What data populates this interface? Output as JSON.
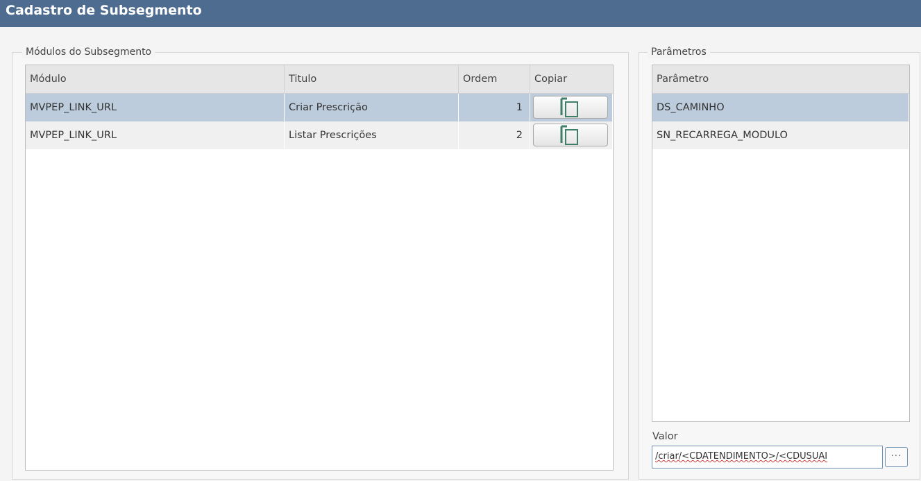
{
  "window": {
    "title": "Cadastro de Subsegmento"
  },
  "modulos": {
    "legend": "Módulos do Subsegmento",
    "columns": [
      "Módulo",
      "Titulo",
      "Ordem",
      "Copiar"
    ],
    "rows": [
      {
        "modulo": "MVPEP_LINK_URL",
        "titulo": "Criar Prescrição",
        "ordem": "1"
      },
      {
        "modulo": "MVPEP_LINK_URL",
        "titulo": "Listar Prescrições",
        "ordem": "2"
      }
    ],
    "copy_icon": "copy-icon"
  },
  "parametros": {
    "legend": "Parâmetros",
    "column": "Parâmetro",
    "rows": [
      "DS_CAMINHO",
      "SN_RECARREGA_MODULO"
    ]
  },
  "valor": {
    "label": "Valor",
    "value": "/criar/<CDATENDIMENTO>/<CDUSUAI",
    "button_label": "···"
  },
  "colors": {
    "title_bar": "#4d6c8f",
    "selected_row": "#bcccdc",
    "copy_icon": "#3f7f6a"
  }
}
